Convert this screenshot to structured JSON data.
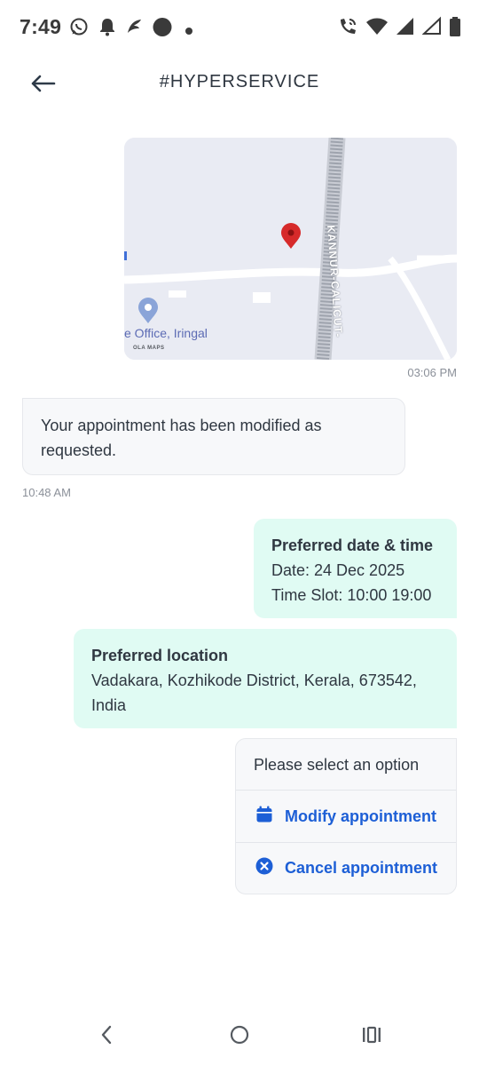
{
  "status_bar": {
    "time": "7:49",
    "left_icons": [
      "whatsapp-icon",
      "bell-icon",
      "app-logo-icon",
      "circle-icon",
      "dot-icon"
    ],
    "right_icons": [
      "wifi-calling-icon",
      "wifi-icon",
      "signal-icon",
      "signal-empty-icon",
      "battery-icon"
    ]
  },
  "header": {
    "title": "#HYPERSERVICE",
    "back_icon": "arrow-left-icon"
  },
  "messages": {
    "map": {
      "road_label": "KANNUR-CALICUT-",
      "place_label": "e Office, Iringal",
      "attribution": "OLA MAPS",
      "time": "03:06 PM"
    },
    "modified": {
      "text": "Your appointment has been modified as requested.",
      "time": "10:48 AM"
    },
    "datetime": {
      "title": "Preferred date & time",
      "date": "Date: 24 Dec 2025",
      "slot": "Time Slot: 10:00 19:00"
    },
    "location": {
      "title": "Preferred location",
      "address": "Vadakara, Kozhikode District, Kerala, 673542, India"
    },
    "options": {
      "prompt": "Please select an option",
      "modify_label": "Modify appointment",
      "cancel_label": "Cancel appointment"
    }
  },
  "colors": {
    "accent": "#1d5fd6",
    "outgoing_bubble": "#e0fbf3",
    "incoming_bubble": "#f7f8fa",
    "map_pin": "#d62a2a"
  },
  "nav_bar": {
    "icons": [
      "nav-back-icon",
      "nav-home-icon",
      "nav-recents-icon"
    ]
  }
}
